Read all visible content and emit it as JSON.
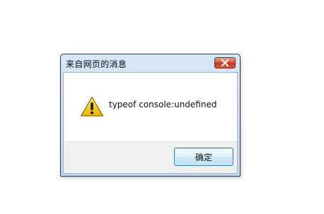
{
  "dialog": {
    "title": "来自网页的消息",
    "message": "typeof console:undefined",
    "ok_label": "确定",
    "icon": "warning-icon",
    "close_icon": "close-icon"
  },
  "colors": {
    "title_bar": "#c3d8ee",
    "close_button": "#c2371e",
    "warning_yellow": "#f5c400",
    "button_border": "#3c7fb1"
  }
}
